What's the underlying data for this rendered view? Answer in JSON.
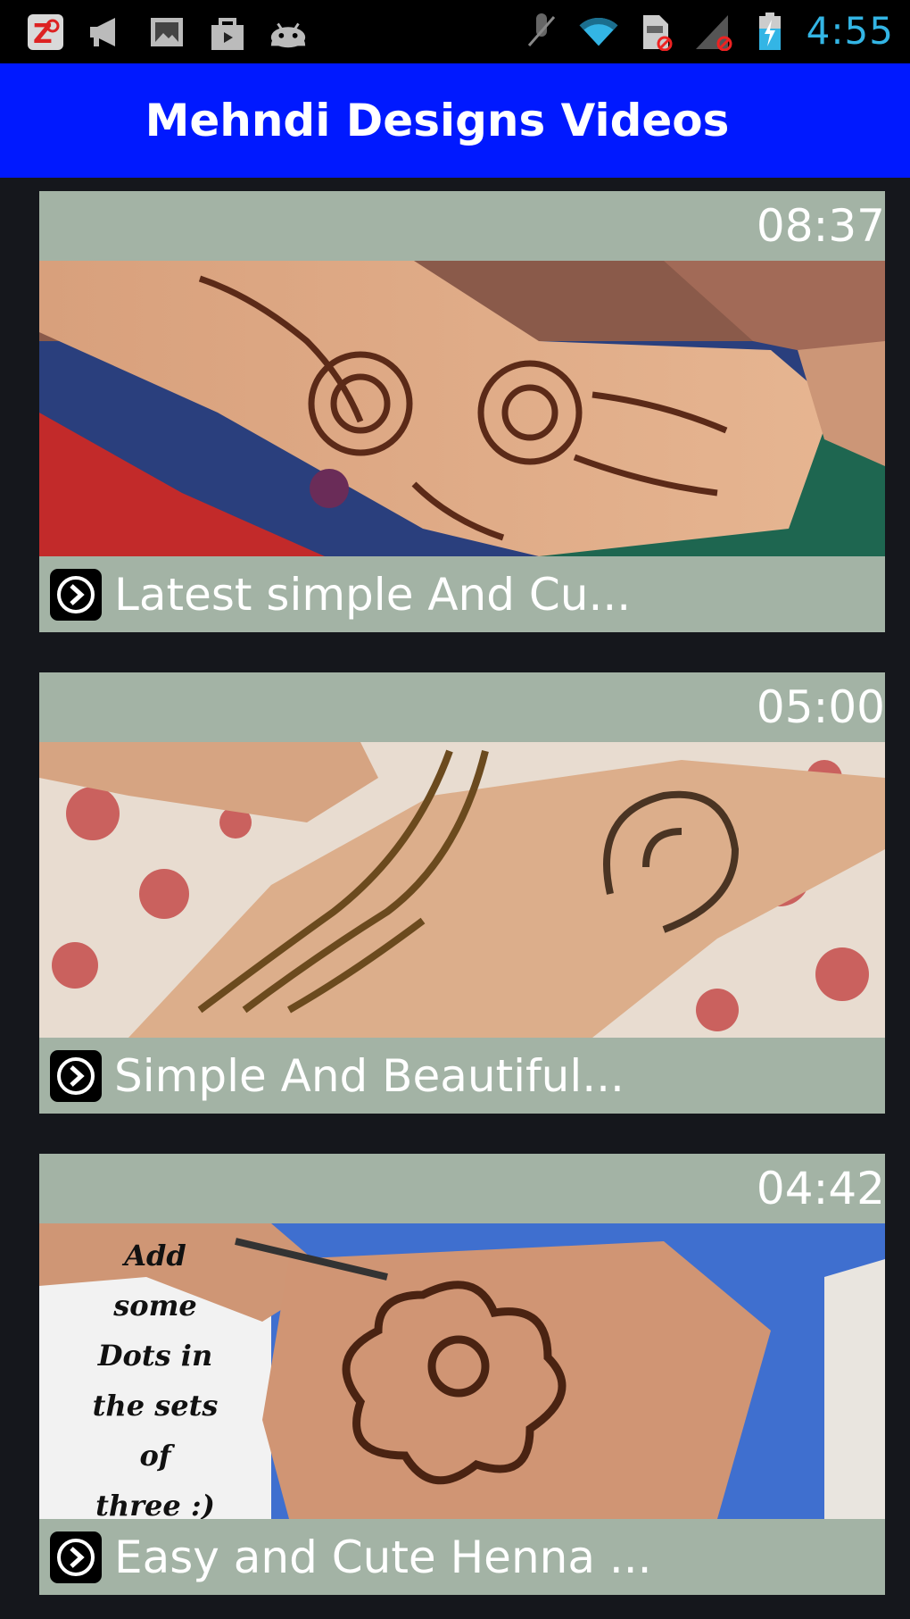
{
  "status_bar": {
    "time": "4:55",
    "left_icons": [
      "news-app-icon",
      "megaphone-icon",
      "gallery-icon",
      "shopping-bag-icon",
      "android-icon"
    ],
    "right_icons": [
      "mute-icon",
      "wifi-icon",
      "sd-card-icon",
      "signal-icon",
      "battery-icon"
    ]
  },
  "header": {
    "title": "Mehndi Designs Videos"
  },
  "videos": [
    {
      "duration": "08:37",
      "title": "Latest simple And Cu..."
    },
    {
      "duration": "05:00",
      "title": "Simple And Beautiful..."
    },
    {
      "duration": "04:42",
      "title": "Easy and Cute Henna ..."
    }
  ],
  "thumb_overlay": {
    "lines": [
      "Add",
      "some",
      "Dots in",
      "the sets",
      "of",
      "three :)"
    ]
  }
}
